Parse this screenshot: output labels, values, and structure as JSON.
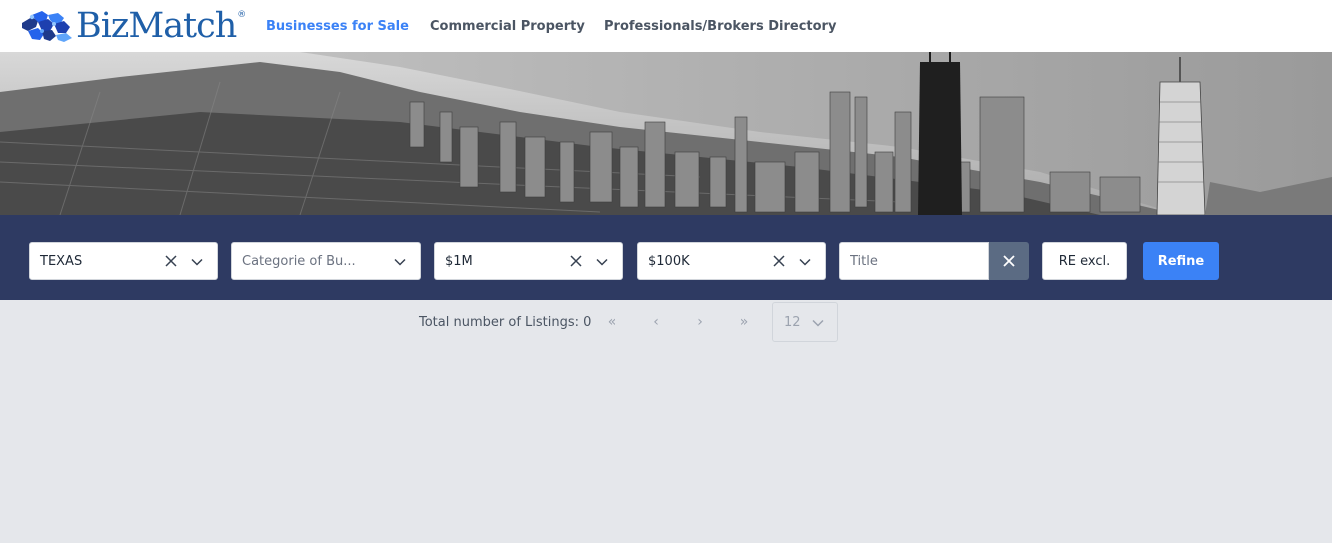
{
  "header": {
    "logo_text": "BizMatch",
    "logo_reg": "®",
    "nav": [
      {
        "label": "Businesses for Sale",
        "active": true
      },
      {
        "label": "Commercial Property",
        "active": false
      },
      {
        "label": "Professionals/Brokers Directory",
        "active": false
      }
    ]
  },
  "filters": {
    "state": {
      "value": "TEXAS"
    },
    "category": {
      "placeholder": "Categorie of Bu..."
    },
    "max_price": {
      "value": "$1M"
    },
    "min_cashflow": {
      "value": "$100K"
    },
    "title": {
      "placeholder": "Title"
    },
    "re_excl_label": "RE excl.",
    "refine_label": "Refine"
  },
  "results": {
    "total_label": "Total number of Listings: 0",
    "first_page": "«",
    "prev_page": "‹",
    "next_page": "›",
    "last_page": "»",
    "page_size": "12"
  },
  "colors": {
    "accent": "#3b82f6",
    "filter_bar": "#2e3a62",
    "page_bg": "#e5e7eb"
  }
}
